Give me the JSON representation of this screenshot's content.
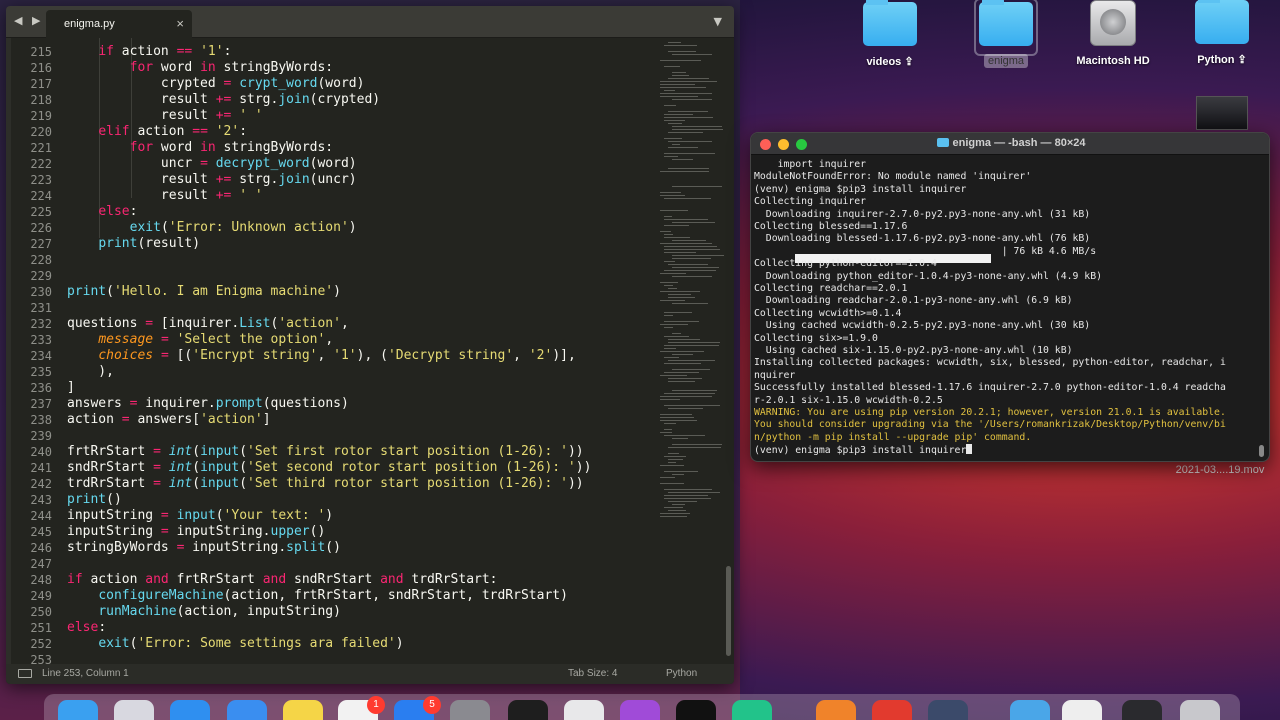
{
  "editor": {
    "tab_title": "enigma.py",
    "close_glyph": "×",
    "nav_arrows": "◀ ▶",
    "dropdown_glyph": "▼",
    "status_position": "Line 253, Column 1",
    "status_tab_size": "Tab Size: 4",
    "status_language": "Python",
    "code_lines": [
      {
        "n": "215",
        "tokens": [
          {
            "t": "    "
          },
          {
            "t": "if",
            "c": "kw"
          },
          {
            "t": " action "
          },
          {
            "t": "==",
            "c": "kw"
          },
          {
            "t": " "
          },
          {
            "t": "'1'",
            "c": "st"
          },
          {
            "t": ":"
          }
        ]
      },
      {
        "n": "216",
        "tokens": [
          {
            "t": "        "
          },
          {
            "t": "for",
            "c": "kw"
          },
          {
            "t": " word "
          },
          {
            "t": "in",
            "c": "kw"
          },
          {
            "t": " stringByWords:"
          }
        ]
      },
      {
        "n": "217",
        "tokens": [
          {
            "t": "            crypted "
          },
          {
            "t": "=",
            "c": "kw"
          },
          {
            "t": " "
          },
          {
            "t": "crypt_word",
            "c": "fn"
          },
          {
            "t": "(word)"
          }
        ]
      },
      {
        "n": "218",
        "tokens": [
          {
            "t": "            result "
          },
          {
            "t": "+=",
            "c": "kw"
          },
          {
            "t": " strg."
          },
          {
            "t": "join",
            "c": "fn"
          },
          {
            "t": "(crypted)"
          }
        ]
      },
      {
        "n": "219",
        "tokens": [
          {
            "t": "            result "
          },
          {
            "t": "+=",
            "c": "kw"
          },
          {
            "t": " "
          },
          {
            "t": "' '",
            "c": "st"
          }
        ]
      },
      {
        "n": "220",
        "tokens": [
          {
            "t": "    "
          },
          {
            "t": "elif",
            "c": "kw"
          },
          {
            "t": " action "
          },
          {
            "t": "==",
            "c": "kw"
          },
          {
            "t": " "
          },
          {
            "t": "'2'",
            "c": "st"
          },
          {
            "t": ":"
          }
        ]
      },
      {
        "n": "221",
        "tokens": [
          {
            "t": "        "
          },
          {
            "t": "for",
            "c": "kw"
          },
          {
            "t": " word "
          },
          {
            "t": "in",
            "c": "kw"
          },
          {
            "t": " stringByWords:"
          }
        ]
      },
      {
        "n": "222",
        "tokens": [
          {
            "t": "            uncr "
          },
          {
            "t": "=",
            "c": "kw"
          },
          {
            "t": " "
          },
          {
            "t": "decrypt_word",
            "c": "fn"
          },
          {
            "t": "(word)"
          }
        ]
      },
      {
        "n": "223",
        "tokens": [
          {
            "t": "            result "
          },
          {
            "t": "+=",
            "c": "kw"
          },
          {
            "t": " strg."
          },
          {
            "t": "join",
            "c": "fn"
          },
          {
            "t": "(uncr)"
          }
        ]
      },
      {
        "n": "224",
        "tokens": [
          {
            "t": "            result "
          },
          {
            "t": "+=",
            "c": "kw"
          },
          {
            "t": " "
          },
          {
            "t": "' '",
            "c": "st"
          }
        ]
      },
      {
        "n": "225",
        "tokens": [
          {
            "t": "    "
          },
          {
            "t": "else",
            "c": "kw"
          },
          {
            "t": ":"
          }
        ]
      },
      {
        "n": "226",
        "tokens": [
          {
            "t": "        "
          },
          {
            "t": "exit",
            "c": "fn"
          },
          {
            "t": "("
          },
          {
            "t": "'Error: Unknown action'",
            "c": "st"
          },
          {
            "t": ")"
          }
        ]
      },
      {
        "n": "227",
        "tokens": [
          {
            "t": "    "
          },
          {
            "t": "print",
            "c": "fn"
          },
          {
            "t": "(result)"
          }
        ]
      },
      {
        "n": "228",
        "tokens": []
      },
      {
        "n": "229",
        "tokens": []
      },
      {
        "n": "230",
        "tokens": [
          {
            "t": "print",
            "c": "fn"
          },
          {
            "t": "("
          },
          {
            "t": "'Hello. I am Enigma machine'",
            "c": "st"
          },
          {
            "t": ")"
          }
        ]
      },
      {
        "n": "231",
        "tokens": []
      },
      {
        "n": "232",
        "tokens": [
          {
            "t": "questions "
          },
          {
            "t": "=",
            "c": "kw"
          },
          {
            "t": " [inquirer."
          },
          {
            "t": "List",
            "c": "fn"
          },
          {
            "t": "("
          },
          {
            "t": "'action'",
            "c": "st"
          },
          {
            "t": ","
          }
        ]
      },
      {
        "n": "233",
        "tokens": [
          {
            "t": "    "
          },
          {
            "t": "message",
            "c": "pa"
          },
          {
            "t": " "
          },
          {
            "t": "=",
            "c": "kw"
          },
          {
            "t": " "
          },
          {
            "t": "'Select the option'",
            "c": "st"
          },
          {
            "t": ","
          }
        ]
      },
      {
        "n": "234",
        "tokens": [
          {
            "t": "    "
          },
          {
            "t": "choices",
            "c": "pa"
          },
          {
            "t": " "
          },
          {
            "t": "=",
            "c": "kw"
          },
          {
            "t": " [("
          },
          {
            "t": "'Encrypt string'",
            "c": "st"
          },
          {
            "t": ", "
          },
          {
            "t": "'1'",
            "c": "st"
          },
          {
            "t": "), ("
          },
          {
            "t": "'Decrypt string'",
            "c": "st"
          },
          {
            "t": ", "
          },
          {
            "t": "'2'",
            "c": "st"
          },
          {
            "t": ")],"
          }
        ]
      },
      {
        "n": "235",
        "tokens": [
          {
            "t": "    ),"
          }
        ]
      },
      {
        "n": "236",
        "tokens": [
          {
            "t": "]"
          }
        ]
      },
      {
        "n": "237",
        "tokens": [
          {
            "t": "answers "
          },
          {
            "t": "=",
            "c": "kw"
          },
          {
            "t": " inquirer."
          },
          {
            "t": "prompt",
            "c": "fn"
          },
          {
            "t": "(questions)"
          }
        ]
      },
      {
        "n": "238",
        "tokens": [
          {
            "t": "action "
          },
          {
            "t": "=",
            "c": "kw"
          },
          {
            "t": " answers["
          },
          {
            "t": "'action'",
            "c": "st"
          },
          {
            "t": "]"
          }
        ]
      },
      {
        "n": "239",
        "tokens": []
      },
      {
        "n": "240",
        "tokens": [
          {
            "t": "frtRrStart "
          },
          {
            "t": "=",
            "c": "kw"
          },
          {
            "t": " "
          },
          {
            "t": "int",
            "c": "ty"
          },
          {
            "t": "("
          },
          {
            "t": "input",
            "c": "fn"
          },
          {
            "t": "("
          },
          {
            "t": "'Set first rotor start position (1-26): '",
            "c": "st"
          },
          {
            "t": "))"
          }
        ]
      },
      {
        "n": "241",
        "tokens": [
          {
            "t": "sndRrStart "
          },
          {
            "t": "=",
            "c": "kw"
          },
          {
            "t": " "
          },
          {
            "t": "int",
            "c": "ty"
          },
          {
            "t": "("
          },
          {
            "t": "input",
            "c": "fn"
          },
          {
            "t": "("
          },
          {
            "t": "'Set second rotor start position (1-26): '",
            "c": "st"
          },
          {
            "t": "))"
          }
        ]
      },
      {
        "n": "242",
        "tokens": [
          {
            "t": "trdRrStart "
          },
          {
            "t": "=",
            "c": "kw"
          },
          {
            "t": " "
          },
          {
            "t": "int",
            "c": "ty"
          },
          {
            "t": "("
          },
          {
            "t": "input",
            "c": "fn"
          },
          {
            "t": "("
          },
          {
            "t": "'Set third rotor start position (1-26): '",
            "c": "st"
          },
          {
            "t": "))"
          }
        ]
      },
      {
        "n": "243",
        "tokens": [
          {
            "t": "print",
            "c": "fn"
          },
          {
            "t": "()"
          }
        ]
      },
      {
        "n": "244",
        "tokens": [
          {
            "t": "inputString "
          },
          {
            "t": "=",
            "c": "kw"
          },
          {
            "t": " "
          },
          {
            "t": "input",
            "c": "fn"
          },
          {
            "t": "("
          },
          {
            "t": "'Your text: '",
            "c": "st"
          },
          {
            "t": ")"
          }
        ]
      },
      {
        "n": "245",
        "tokens": [
          {
            "t": "inputString "
          },
          {
            "t": "=",
            "c": "kw"
          },
          {
            "t": " inputString."
          },
          {
            "t": "upper",
            "c": "fn"
          },
          {
            "t": "()"
          }
        ]
      },
      {
        "n": "246",
        "tokens": [
          {
            "t": "stringByWords "
          },
          {
            "t": "=",
            "c": "kw"
          },
          {
            "t": " inputString."
          },
          {
            "t": "split",
            "c": "fn"
          },
          {
            "t": "()"
          }
        ]
      },
      {
        "n": "247",
        "tokens": []
      },
      {
        "n": "248",
        "tokens": [
          {
            "t": "if",
            "c": "kw"
          },
          {
            "t": " action "
          },
          {
            "t": "and",
            "c": "kw"
          },
          {
            "t": " frtRrStart "
          },
          {
            "t": "and",
            "c": "kw"
          },
          {
            "t": " sndRrStart "
          },
          {
            "t": "and",
            "c": "kw"
          },
          {
            "t": " trdRrStart:"
          }
        ]
      },
      {
        "n": "249",
        "tokens": [
          {
            "t": "    "
          },
          {
            "t": "configureMachine",
            "c": "fn"
          },
          {
            "t": "(action, frtRrStart, sndRrStart, trdRrStart)"
          }
        ]
      },
      {
        "n": "250",
        "tokens": [
          {
            "t": "    "
          },
          {
            "t": "runMachine",
            "c": "fn"
          },
          {
            "t": "(action, inputString)"
          }
        ]
      },
      {
        "n": "251",
        "tokens": [
          {
            "t": "else",
            "c": "kw"
          },
          {
            "t": ":"
          }
        ]
      },
      {
        "n": "252",
        "tokens": [
          {
            "t": "    "
          },
          {
            "t": "exit",
            "c": "fn"
          },
          {
            "t": "("
          },
          {
            "t": "'Error: Some settings ara failed'",
            "c": "st"
          },
          {
            "t": ")"
          }
        ]
      },
      {
        "n": "253",
        "tokens": []
      }
    ]
  },
  "desktop": {
    "icons": [
      {
        "label": "videos ⇪",
        "type": "folder"
      },
      {
        "label": "enigma",
        "type": "folder",
        "selected": true
      },
      {
        "label": "Macintosh HD",
        "type": "drive"
      },
      {
        "label": "Python ⇪",
        "type": "folder"
      }
    ],
    "movie_label": "2021-03....19.mov"
  },
  "terminal": {
    "title": "enigma — -bash — 80×24",
    "lines": [
      {
        "text": "    import inquirer"
      },
      {
        "text": "ModuleNotFoundError: No module named 'inquirer'"
      },
      {
        "text": "(venv) enigma $pip3 install inquirer"
      },
      {
        "text": "Collecting inquirer"
      },
      {
        "text": "  Downloading inquirer-2.7.0-py2.py3-none-any.whl (31 kB)"
      },
      {
        "text": "Collecting blessed==1.17.6"
      },
      {
        "text": "  Downloading blessed-1.17.6-py2.py3-none-any.whl (76 kB)"
      },
      {
        "text": "                                          | 76 kB 4.6 MB/s"
      },
      {
        "text": "Collecting python-editor==1.0.4"
      },
      {
        "text": "  Downloading python_editor-1.0.4-py3-none-any.whl (4.9 kB)"
      },
      {
        "text": "Collecting readchar==2.0.1"
      },
      {
        "text": "  Downloading readchar-2.0.1-py3-none-any.whl (6.9 kB)"
      },
      {
        "text": "Collecting wcwidth>=0.1.4"
      },
      {
        "text": "  Using cached wcwidth-0.2.5-py2.py3-none-any.whl (30 kB)"
      },
      {
        "text": "Collecting six>=1.9.0"
      },
      {
        "text": "  Using cached six-1.15.0-py2.py3-none-any.whl (10 kB)"
      },
      {
        "text": "Installing collected packages: wcwidth, six, blessed, python-editor, readchar, i"
      },
      {
        "text": "nquirer"
      },
      {
        "text": "Successfully installed blessed-1.17.6 inquirer-2.7.0 python-editor-1.0.4 readcha"
      },
      {
        "text": "r-2.0.1 six-1.15.0 wcwidth-0.2.5"
      },
      {
        "text": "WARNING: You are using pip version 20.2.1; however, version 21.0.1 is available.",
        "warn": true
      },
      {
        "text": "You should consider upgrading via the '/Users/romankrizak/Desktop/Python/venv/bi",
        "warn": true
      },
      {
        "text": "n/python -m pip install --upgrade pip' command.",
        "warn": true
      },
      {
        "text": "(venv) enigma $pip3 install inquirer",
        "cursor": true
      }
    ],
    "download_progress": 1.0
  },
  "dock": {
    "items": [
      "finder-icon",
      "launchpad-icon",
      "safari-icon",
      "mail-icon",
      "notes-icon",
      "reminders-icon",
      "app-store-icon",
      "system-preferences-icon",
      "terminal-icon",
      "script-editor-icon",
      "podcasts-icon",
      "apple-tv-icon",
      "pycharm-icon",
      "sublime-text-icon",
      "chrome-icon",
      "quicktime-icon",
      "downloads-folder-icon",
      "document-stack-icon",
      "screen-recording-icon",
      "trash-icon"
    ],
    "badges": {
      "reminders-icon": "1",
      "app-store-icon": "5"
    }
  },
  "colors": {
    "editor_bg": "#23241f",
    "keyword": "#f92672",
    "string": "#e6db74",
    "function": "#66d9ef",
    "param": "#fd971f",
    "terminal_bg": "#1c1c1c",
    "warning": "#e0c040"
  }
}
